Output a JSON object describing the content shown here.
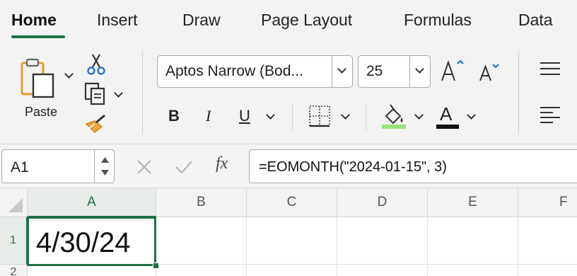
{
  "tabs": [
    {
      "label": "Home",
      "active": true
    },
    {
      "label": "Insert"
    },
    {
      "label": "Draw"
    },
    {
      "label": "Page Layout"
    },
    {
      "label": "Formulas"
    },
    {
      "label": "Data"
    }
  ],
  "clipboard": {
    "paste_label": "Paste",
    "icons": [
      "paste-icon",
      "cut-icon",
      "copy-icon",
      "format-painter-icon"
    ]
  },
  "font": {
    "name": "Aptos Narrow (Bod...",
    "size": "25",
    "increase_icon": "increase-font-size-icon",
    "decrease_icon": "decrease-font-size-icon",
    "bold": "B",
    "italic": "I",
    "underline": "U",
    "font_color_letter": "A",
    "fill_color": "#9be07f",
    "font_color": "#111111"
  },
  "alignment": {
    "icons": [
      "align-top-icon",
      "align-left-icon"
    ]
  },
  "formula_bar": {
    "name_box": "A1",
    "fx": "fx",
    "formula": "=EOMONTH(\"2024-01-15\", 3)"
  },
  "grid": {
    "columns": [
      "A",
      "B",
      "C",
      "D",
      "E",
      "F"
    ],
    "rows": [
      "1",
      "2"
    ],
    "selected_cell": "A1",
    "cells": {
      "A1": "4/30/24"
    }
  },
  "colors": {
    "accent": "#1e7145",
    "ribbon_bg": "#f3f3f3"
  }
}
